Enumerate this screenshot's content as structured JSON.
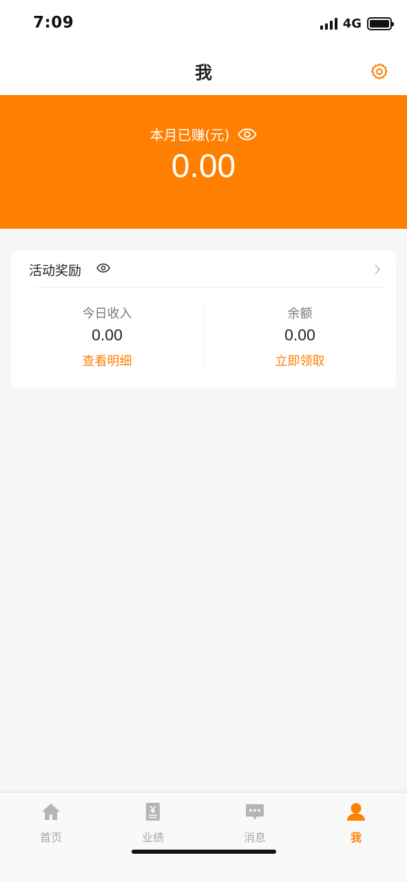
{
  "status_bar": {
    "time": "7:09",
    "network": "4G"
  },
  "nav": {
    "title": "我",
    "settings_icon": "gear-icon"
  },
  "banner": {
    "label": "本月已赚(元)",
    "value": "0.00",
    "visibility_icon": "eye-icon",
    "color": "#ff7f00"
  },
  "card": {
    "title": "活动奖励",
    "visibility_icon": "eye-icon",
    "chevron_icon": "chevron-right-icon",
    "left": {
      "label": "今日收入",
      "value": "0.00",
      "link": "查看明细"
    },
    "right": {
      "label": "余额",
      "value": "0.00",
      "link": "立即领取"
    }
  },
  "tab_bar": {
    "tabs": [
      {
        "label": "首页",
        "icon": "home-icon",
        "active": false
      },
      {
        "label": "业绩",
        "icon": "performance-doc-icon",
        "active": false
      },
      {
        "label": "消息",
        "icon": "message-icon",
        "active": false
      },
      {
        "label": "我",
        "icon": "user-icon",
        "active": true
      }
    ]
  },
  "colors": {
    "accent": "#ff7f00",
    "inactive": "#a8a8a8",
    "background": "#f6f6f6"
  }
}
